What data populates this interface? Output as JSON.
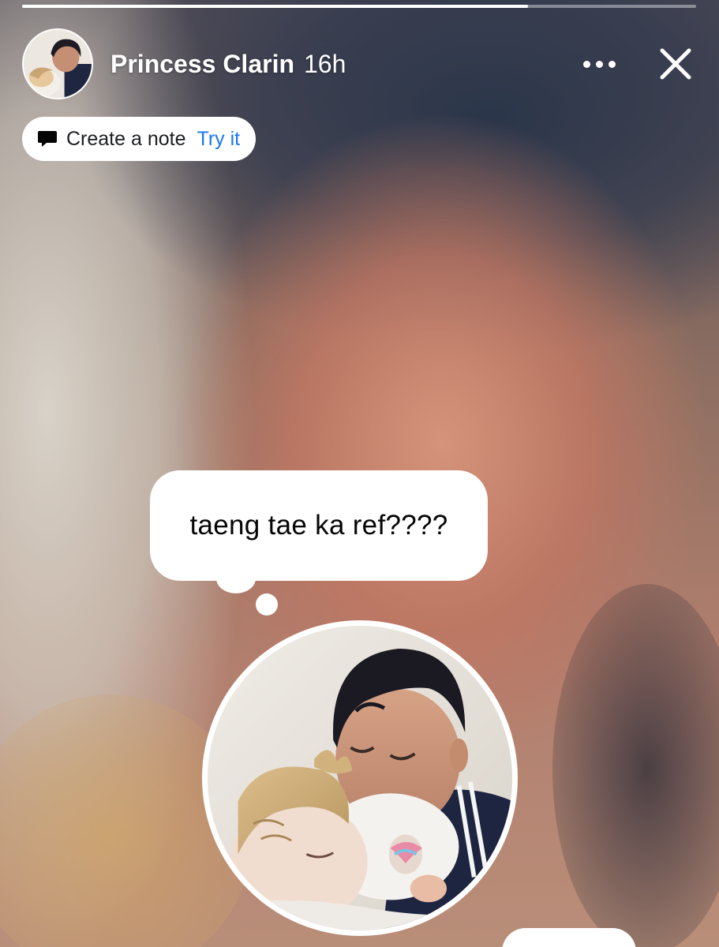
{
  "story": {
    "progress_fraction": 0.75
  },
  "header": {
    "user_name": "Princess Clarin",
    "timestamp": "16h",
    "more_icon": "more-horizontal-icon",
    "close_icon": "close-icon"
  },
  "note_prompt": {
    "icon": "speech-bubble-icon",
    "label": "Create a note",
    "action": "Try it"
  },
  "note": {
    "text": "taeng tae ka ref????"
  },
  "colors": {
    "accent_link": "#1877f2",
    "text_dark": "#1c1e21",
    "overlay_text": "#ffffff"
  }
}
